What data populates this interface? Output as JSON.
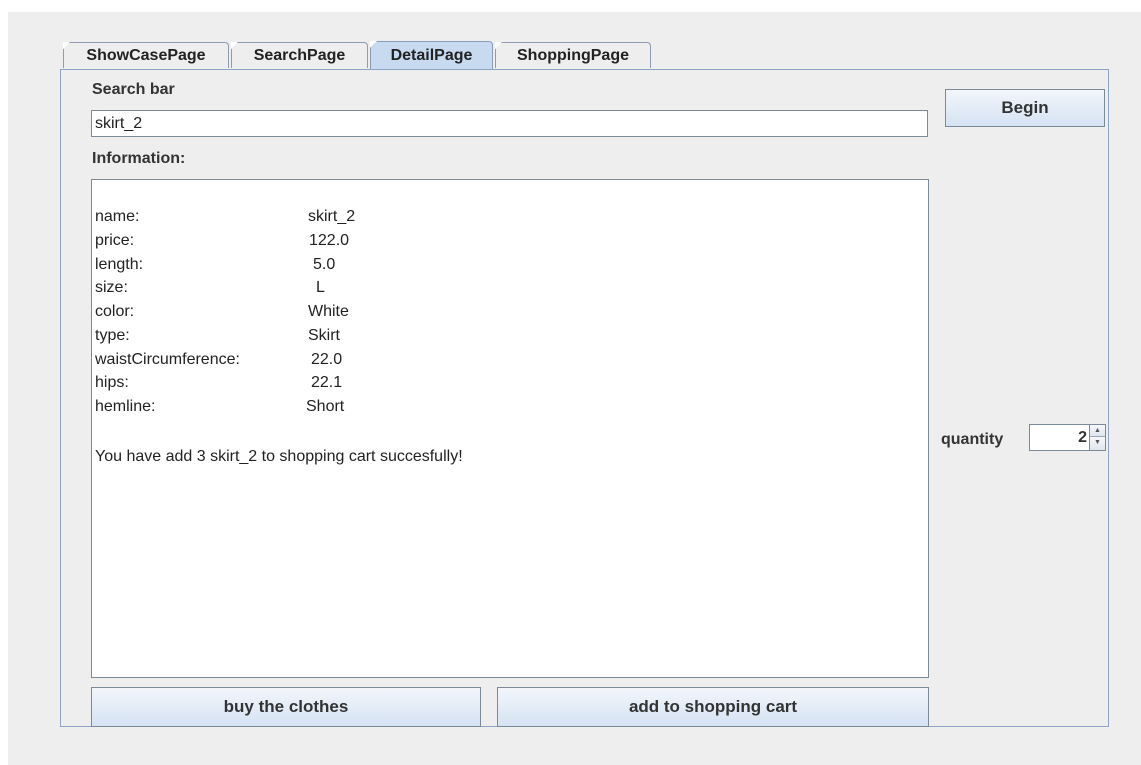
{
  "tabs": [
    {
      "label": "ShowCasePage"
    },
    {
      "label": "SearchPage"
    },
    {
      "label": "DetailPage"
    },
    {
      "label": "ShoppingPage"
    }
  ],
  "selected_tab": "DetailPage",
  "search": {
    "label": "Search bar",
    "value": "skirt_2"
  },
  "info": {
    "label": "Information:",
    "rows": [
      {
        "key": "name:",
        "value": "skirt_2"
      },
      {
        "key": "price:",
        "value": "122.0"
      },
      {
        "key": "length:",
        "value": "5.0"
      },
      {
        "key": "size:",
        "value": "L"
      },
      {
        "key": "color:",
        "value": "White"
      },
      {
        "key": "type:",
        "value": "Skirt"
      },
      {
        "key": "waistCircumference:",
        "value": "22.0"
      },
      {
        "key": "hips:",
        "value": "22.1"
      },
      {
        "key": "hemline:",
        "value": "Short"
      }
    ],
    "message": "You have add 3 skirt_2 to shopping cart succesfully!"
  },
  "buttons": {
    "begin": "Begin",
    "buy": "buy the clothes",
    "add_cart": "add to shopping cart"
  },
  "quantity": {
    "label": "quantity",
    "value": "2",
    "up_glyph": "▲",
    "down_glyph": "▼"
  }
}
